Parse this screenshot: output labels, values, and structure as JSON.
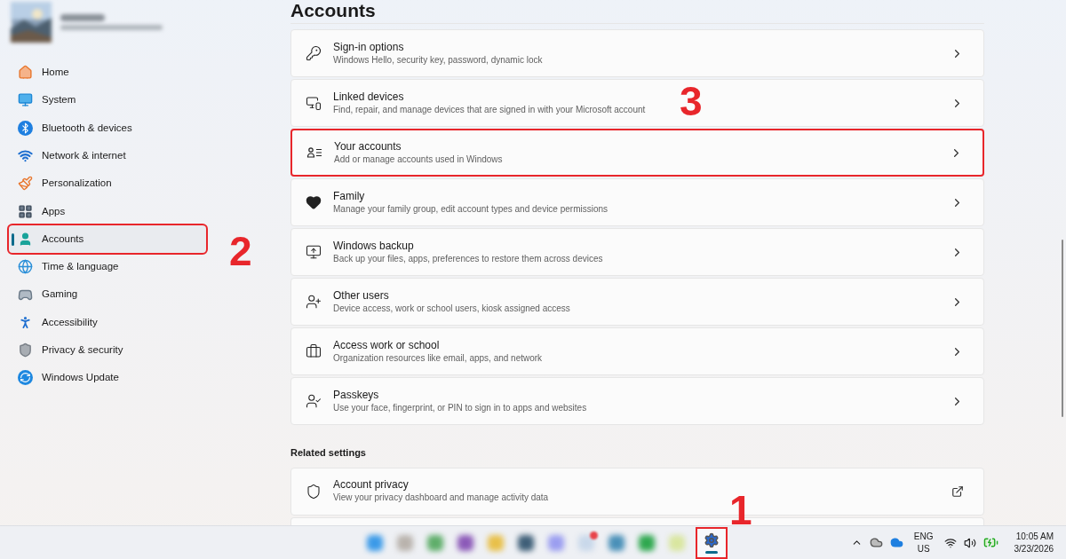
{
  "sidebar": {
    "items": [
      {
        "label": "Home",
        "selected": false,
        "marked": false
      },
      {
        "label": "System",
        "selected": false,
        "marked": false
      },
      {
        "label": "Bluetooth & devices",
        "selected": false,
        "marked": false
      },
      {
        "label": "Network & internet",
        "selected": false,
        "marked": false
      },
      {
        "label": "Personalization",
        "selected": false,
        "marked": false
      },
      {
        "label": "Apps",
        "selected": false,
        "marked": false
      },
      {
        "label": "Accounts",
        "selected": true,
        "marked": true,
        "callout": "2"
      },
      {
        "label": "Time & language",
        "selected": false,
        "marked": false
      },
      {
        "label": "Gaming",
        "selected": false,
        "marked": false
      },
      {
        "label": "Accessibility",
        "selected": false,
        "marked": false
      },
      {
        "label": "Privacy & security",
        "selected": false,
        "marked": false
      },
      {
        "label": "Windows Update",
        "selected": false,
        "marked": false
      }
    ]
  },
  "page": {
    "title": "Accounts",
    "cards": [
      {
        "title": "Sign-in options",
        "subtitle": "Windows Hello, security key, password, dynamic lock",
        "kind": "page",
        "marked": false
      },
      {
        "title": "Linked devices",
        "subtitle": "Find, repair, and manage devices that are signed in with your Microsoft account",
        "kind": "page",
        "marked": false
      },
      {
        "title": "Your accounts",
        "subtitle": "Add or manage accounts used in Windows",
        "kind": "page",
        "marked": true,
        "callout": "3"
      },
      {
        "title": "Family",
        "subtitle": "Manage your family group, edit account types and device permissions",
        "kind": "page",
        "marked": false
      },
      {
        "title": "Windows backup",
        "subtitle": "Back up your files, apps, preferences to restore them across devices",
        "kind": "page",
        "marked": false
      },
      {
        "title": "Other users",
        "subtitle": "Device access, work or school users, kiosk assigned access",
        "kind": "page",
        "marked": false
      },
      {
        "title": "Access work or school",
        "subtitle": "Organization resources like email, apps, and network",
        "kind": "page",
        "marked": false
      },
      {
        "title": "Passkeys",
        "subtitle": "Use your face, fingerprint, or PIN to sign in to apps and websites",
        "kind": "page",
        "marked": false
      }
    ],
    "related_heading": "Related settings",
    "related_cards": [
      {
        "title": "Account privacy",
        "subtitle": "View your privacy dashboard and manage activity data",
        "kind": "external",
        "marked": false
      }
    ]
  },
  "taskbar": {
    "apps": [
      {
        "badge": false
      },
      {
        "badge": false
      },
      {
        "badge": false
      },
      {
        "badge": false
      },
      {
        "badge": false
      },
      {
        "badge": false
      },
      {
        "badge": false
      },
      {
        "badge": true
      },
      {
        "badge": false
      },
      {
        "badge": false
      },
      {
        "badge": false
      }
    ],
    "settings": {
      "selected": true,
      "marked": true,
      "callout": "1"
    },
    "tray": {
      "language": "ENG",
      "region": "US",
      "time": "10:05 AM",
      "date": "3/23/2026"
    }
  }
}
